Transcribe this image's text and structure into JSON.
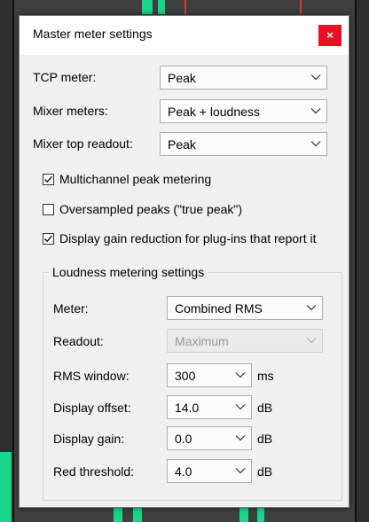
{
  "dialog": {
    "title": "Master meter settings",
    "close_glyph": "×"
  },
  "fields": {
    "tcp_meter": {
      "label": "TCP meter:",
      "value": "Peak"
    },
    "mixer_meters": {
      "label": "Mixer meters:",
      "value": "Peak + loudness"
    },
    "mixer_top_readout": {
      "label": "Mixer top readout:",
      "value": "Peak"
    }
  },
  "checkboxes": [
    {
      "label": "Multichannel peak metering",
      "checked": true
    },
    {
      "label": "Oversampled peaks (\"true peak\")",
      "checked": false
    },
    {
      "label": "Display gain reduction for plug-ins that report it",
      "checked": true
    }
  ],
  "loudness": {
    "group_title": "Loudness metering settings",
    "meter": {
      "label": "Meter:",
      "value": "Combined RMS"
    },
    "readout": {
      "label": "Readout:",
      "value": "Maximum",
      "disabled": true
    },
    "rms_window": {
      "label": "RMS window:",
      "value": "300",
      "unit": "ms"
    },
    "display_offset": {
      "label": "Display offset:",
      "value": "14.0",
      "unit": "dB"
    },
    "display_gain": {
      "label": "Display gain:",
      "value": "0.0",
      "unit": "dB"
    },
    "red_threshold": {
      "label": "Red threshold:",
      "value": "4.0",
      "unit": "dB"
    }
  },
  "colors": {
    "close_bg": "#e81123",
    "meter_green": "#19d68a",
    "dialog_bg": "#f0f0f0"
  }
}
